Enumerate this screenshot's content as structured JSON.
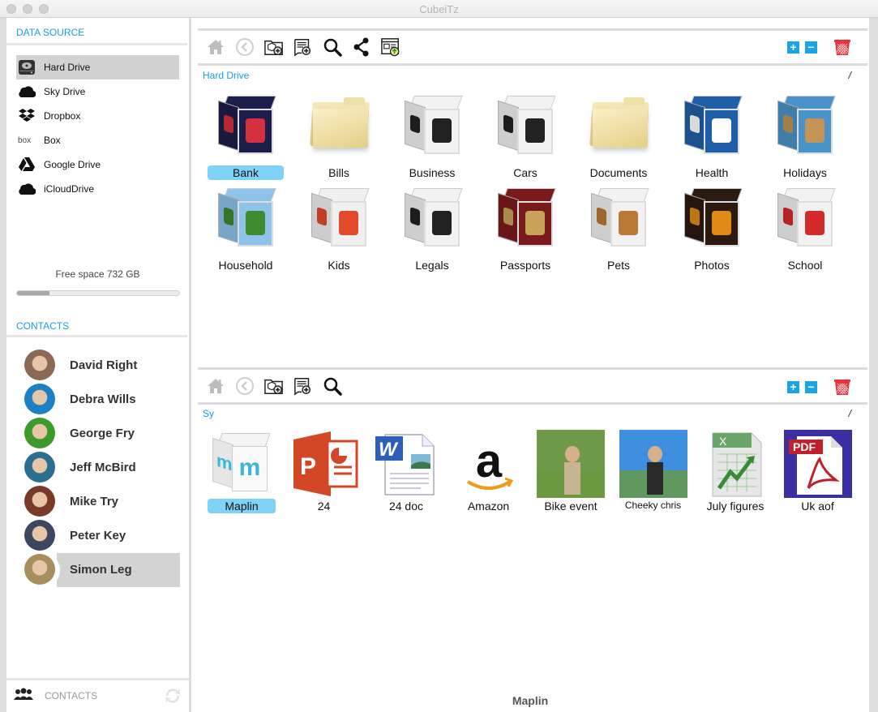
{
  "window": {
    "title": "CubeiTz"
  },
  "sidebar": {
    "data_source_title": "DATA SOURCE",
    "data_sources": [
      {
        "label": "Hard Drive",
        "icon": "hard-drive-icon",
        "selected": true
      },
      {
        "label": "Sky Drive",
        "icon": "cloud-icon",
        "selected": false
      },
      {
        "label": "Dropbox",
        "icon": "dropbox-icon",
        "selected": false
      },
      {
        "label": "Box",
        "icon": "box-logo-icon",
        "selected": false
      },
      {
        "label": "Google Drive",
        "icon": "google-drive-icon",
        "selected": false
      },
      {
        "label": "iCloudDrive",
        "icon": "cloud-icon",
        "selected": false
      }
    ],
    "free_space": "Free space 732 GB",
    "storage_used_fraction": 0.2,
    "contacts_title": "CONTACTS",
    "contacts": [
      {
        "name": "David Right",
        "avatar_color": "#8a6a55",
        "selected": false
      },
      {
        "name": "Debra Wills",
        "avatar_color": "#1d7fc4",
        "selected": false
      },
      {
        "name": "George Fry",
        "avatar_color": "#3a9a2a",
        "selected": false
      },
      {
        "name": "Jeff McBird",
        "avatar_color": "#2b6e8f",
        "selected": false
      },
      {
        "name": "Mike Try",
        "avatar_color": "#7a3a2a",
        "selected": false
      },
      {
        "name": "Peter Key",
        "avatar_color": "#3c4660",
        "selected": false
      },
      {
        "name": "Simon Leg",
        "avatar_color": "#a88e5c",
        "selected": true
      }
    ],
    "footer_label": "CONTACTS",
    "footer_icon": "people-icon",
    "refresh_icon": "refresh-icon"
  },
  "top_pane": {
    "toolbar": [
      {
        "name": "home-icon",
        "enabled": false
      },
      {
        "name": "back-icon",
        "enabled": false
      },
      {
        "name": "add-cube-icon",
        "enabled": true
      },
      {
        "name": "add-document-icon",
        "enabled": true
      },
      {
        "name": "search-icon",
        "enabled": true
      },
      {
        "name": "share-icon",
        "enabled": true
      },
      {
        "name": "upload-window-icon",
        "enabled": true
      }
    ],
    "breadcrumb": "Hard Drive",
    "path": "/",
    "items": [
      {
        "label": "Bank",
        "kind": "cube",
        "colors": [
          "#1b1d4a",
          "#d5303d"
        ],
        "selected": true
      },
      {
        "label": "Bills",
        "kind": "folder",
        "selected": false
      },
      {
        "label": "Business",
        "kind": "cube",
        "colors": [
          "#f2f2f2",
          "#222222"
        ],
        "selected": false
      },
      {
        "label": "Cars",
        "kind": "cube",
        "colors": [
          "#f2f2f2",
          "#222222"
        ],
        "selected": false
      },
      {
        "label": "Documents",
        "kind": "folder",
        "selected": false
      },
      {
        "label": "Health",
        "kind": "cube",
        "colors": [
          "#1f5fa8",
          "#ffffff"
        ],
        "selected": false
      },
      {
        "label": "Holidays",
        "kind": "cube",
        "colors": [
          "#4a93c9",
          "#c49455"
        ],
        "selected": false
      },
      {
        "label": "Household",
        "kind": "cube",
        "colors": [
          "#8ec3ea",
          "#3d8a2f"
        ],
        "selected": false
      },
      {
        "label": "Kids",
        "kind": "cube",
        "colors": [
          "#f0f0f0",
          "#e34a2a"
        ],
        "selected": false
      },
      {
        "label": "Legals",
        "kind": "cube",
        "colors": [
          "#f2f2f2",
          "#222222"
        ],
        "selected": false
      },
      {
        "label": "Passports",
        "kind": "cube",
        "colors": [
          "#7a1a1c",
          "#c9a35a"
        ],
        "selected": false
      },
      {
        "label": "Pets",
        "kind": "cube",
        "colors": [
          "#f2f2f2",
          "#b97a35"
        ],
        "selected": false
      },
      {
        "label": "Photos",
        "kind": "cube",
        "colors": [
          "#2a1a10",
          "#e08a1a"
        ],
        "selected": false
      },
      {
        "label": "School",
        "kind": "cube",
        "colors": [
          "#f2f2f2",
          "#d52a2a"
        ],
        "selected": false
      }
    ]
  },
  "bottom_pane": {
    "toolbar": [
      {
        "name": "home-icon",
        "enabled": false
      },
      {
        "name": "back-icon",
        "enabled": false
      },
      {
        "name": "add-cube-icon",
        "enabled": true
      },
      {
        "name": "add-document-icon",
        "enabled": true
      },
      {
        "name": "search-icon",
        "enabled": true
      }
    ],
    "breadcrumb": "Sy",
    "path": "/",
    "items": [
      {
        "label": "Maplin",
        "kind": "maplin-cube",
        "selected": true
      },
      {
        "label": "24",
        "kind": "powerpoint",
        "selected": false
      },
      {
        "label": "24 doc",
        "kind": "word",
        "selected": false
      },
      {
        "label": "Amazon",
        "kind": "amazon",
        "selected": false
      },
      {
        "label": "Bike event",
        "kind": "photo",
        "colors": [
          "#6f9a4a",
          "#c8b491"
        ],
        "selected": false
      },
      {
        "label": "Cheeky chris",
        "kind": "photo",
        "colors": [
          "#3f8fe0",
          "#2a2a2a"
        ],
        "selected": false,
        "small": true
      },
      {
        "label": "July figures",
        "kind": "excel",
        "selected": false
      },
      {
        "label": "Uk aof",
        "kind": "pdf",
        "selected": false
      }
    ]
  },
  "pane_controls": {
    "zoom_in": "+",
    "zoom_out": "−"
  },
  "status": "Maplin"
}
